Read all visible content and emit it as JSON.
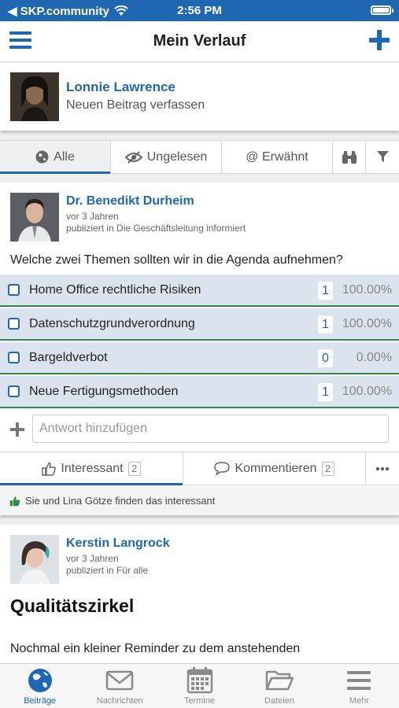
{
  "status_bar": {
    "carrier": "◀ SKP.community",
    "time": "2:56 PM"
  },
  "nav": {
    "title": "Mein Verlauf"
  },
  "composer": {
    "user_name": "Lonnie Lawrence",
    "prompt": "Neuen Beitrag verfassen"
  },
  "filters": {
    "all": "Alle",
    "unread": "Ungelesen",
    "mentioned": "@ Erwähnt"
  },
  "poll_post": {
    "author": "Dr. Benedikt Durheim",
    "time_ago": "vor 3 Jahren",
    "published_in": "publiziert in Die Geschäftsleitung informiert",
    "question": "Welche zwei Themen sollten wir in die Agenda aufnehmen?",
    "options": [
      {
        "label": "Home Office rechtliche Risiken",
        "count": "1",
        "percent": "100.00%",
        "fill": 1.0
      },
      {
        "label": "Datenschutzgrundverordnung",
        "count": "1",
        "percent": "100.00%",
        "fill": 1.0
      },
      {
        "label": "Bargeldverbot",
        "count": "0",
        "percent": "0.00%",
        "fill": 0.0
      },
      {
        "label": "Neue Fertigungsmethoden",
        "count": "1",
        "percent": "100.00%",
        "fill": 1.0
      }
    ],
    "answer_placeholder": "Antwort hinzufügen",
    "like_label": "Interessant",
    "like_count": "2",
    "comment_label": "Kommentieren",
    "comment_count": "2",
    "likes_text": "Sie und Lina Götze finden das interessant"
  },
  "second_post": {
    "author": "Kerstin Langrock",
    "time_ago": "vor 3 Jahren",
    "published_in": "publiziert in Für alle",
    "headline": "Qualitätszirkel",
    "body": "Nochmal ein kleiner Reminder zu dem anstehenden"
  },
  "tab_bar": {
    "items": [
      {
        "label": "Beiträge",
        "icon": "globe-icon"
      },
      {
        "label": "Nachrichten",
        "icon": "envelope-icon"
      },
      {
        "label": "Termine",
        "icon": "calendar-icon"
      },
      {
        "label": "Dateien",
        "icon": "folder-icon"
      },
      {
        "label": "Mehr",
        "icon": "menu-icon"
      }
    ],
    "active": 0
  },
  "colors": {
    "brand": "#1f67b1",
    "poll_option_bg": "#dae3ee",
    "poll_bar": "#2e8b43"
  }
}
